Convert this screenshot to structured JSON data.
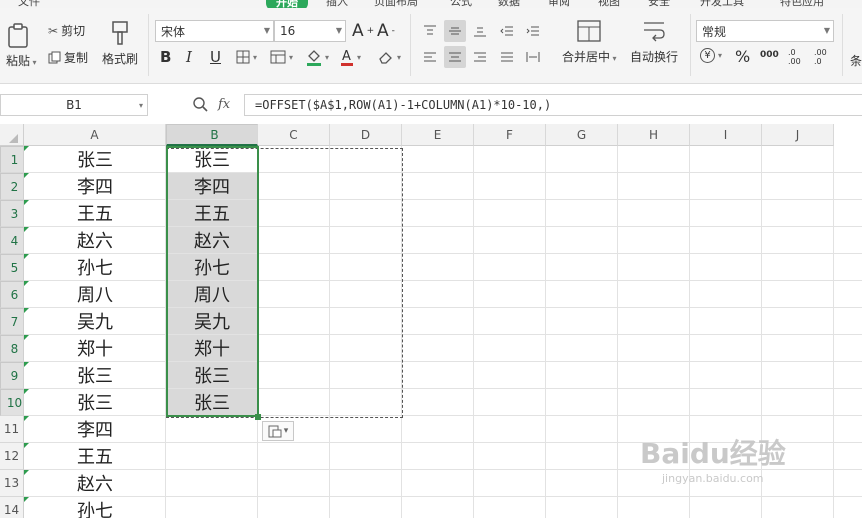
{
  "menu": {
    "tabs": [
      "文件",
      "开始",
      "插入",
      "页面布局",
      "公式",
      "数据",
      "审阅",
      "视图",
      "安全",
      "开发工具",
      "特色应用"
    ],
    "active_tab": "开始"
  },
  "ribbon": {
    "paste_label": "粘贴",
    "cut_label": "剪切",
    "copy_label": "复制",
    "format_painter_label": "格式刷",
    "font_name": "宋体",
    "font_size": "16",
    "increase_font_label": "A",
    "decrease_font_label": "A",
    "bold_label": "B",
    "italic_label": "I",
    "underline_label": "U",
    "merge_center_label": "合并居中",
    "wrap_text_label": "自动换行",
    "number_format": "常规",
    "currency_symbol": "¥",
    "percent_symbol": "%",
    "thousands_label": "000",
    "inc_decimal_label": ".0 .00",
    "dec_decimal_label": ".00 .0",
    "conditional_label": "条",
    "accent_color": "#217346",
    "font_color": "#d0312d",
    "fill_color": "#2ca85b"
  },
  "formula_bar": {
    "name_box": "B1",
    "fx_label": "fx",
    "formula": "=OFFSET($A$1,ROW(A1)-1+COLUMN(A1)*10-10,)"
  },
  "sheet": {
    "columns": [
      "A",
      "B",
      "C",
      "D",
      "E",
      "F",
      "G",
      "H",
      "I",
      "J"
    ],
    "rows": [
      "1",
      "2",
      "3",
      "4",
      "5",
      "6",
      "7",
      "8",
      "9",
      "10",
      "11",
      "12",
      "13",
      "14"
    ],
    "selected_column": "B",
    "column_a": [
      "张三",
      "李四",
      "王五",
      "赵六",
      "孙七",
      "周八",
      "吴九",
      "郑十",
      "张三",
      "张三",
      "李四",
      "王五",
      "赵六",
      "孙七"
    ],
    "column_b": [
      "张三",
      "李四",
      "王五",
      "赵六",
      "孙七",
      "周八",
      "吴九",
      "郑十",
      "张三",
      "张三"
    ]
  },
  "watermark": {
    "brand": "Baidu经验",
    "url": "jingyan.baidu.com"
  }
}
